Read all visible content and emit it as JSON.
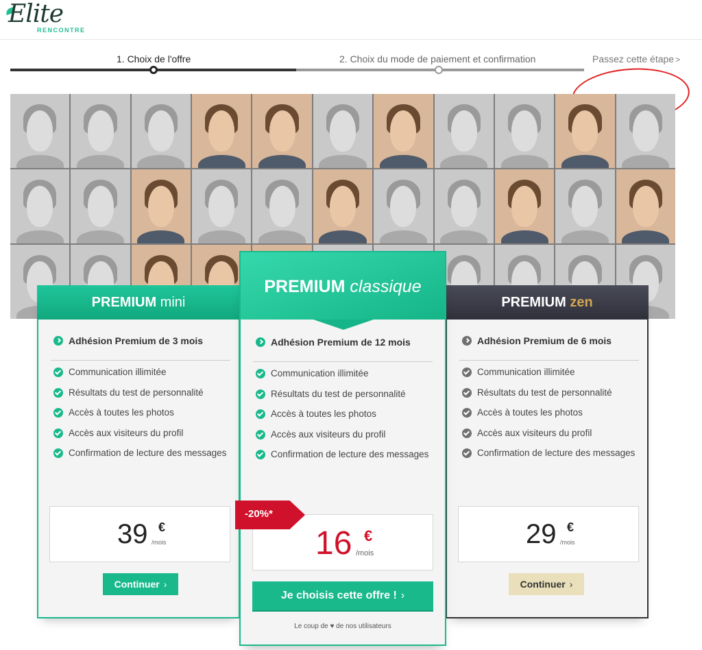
{
  "brand": {
    "logo_text": "Elite",
    "logo_sub": "RENCONTRE"
  },
  "steps": {
    "step1": "1. Choix de l'offre",
    "step2": "2. Choix du mode de paiement et confirmation",
    "skip": "Passez cette étape",
    "skip_icon": ">"
  },
  "plans": {
    "mini": {
      "title_bold": "PREMIUM",
      "title_rest": "mini",
      "main_feature": "Adhésion Premium de 3 mois",
      "features": [
        "Communication illimitée",
        "Résultats du test de personnalité",
        "Accès à toutes les photos",
        "Accès aux visiteurs du profil",
        "Confirmation de lecture des messages"
      ],
      "price": "39",
      "currency": "€",
      "per": "/mois",
      "button": "Continuer"
    },
    "classic": {
      "title_bold": "PREMIUM",
      "title_rest": "classique",
      "main_feature": "Adhésion Premium de 12 mois",
      "features": [
        "Communication illimitée",
        "Résultats du test de personnalité",
        "Accès à toutes les photos",
        "Accès aux visiteurs du profil",
        "Confirmation de lecture des messages"
      ],
      "badge": "-20%*",
      "price": "16",
      "currency": "€",
      "per": "/mois",
      "button": "Je choisis cette offre !",
      "tagline": "Le coup de ♥ de nos utilisateurs"
    },
    "zen": {
      "title_bold": "PREMIUM",
      "title_rest": "zen",
      "main_feature": "Adhésion Premium de 6 mois",
      "features": [
        "Communication illimitée",
        "Résultats du test de personnalité",
        "Accès à toutes les photos",
        "Accès aux visiteurs du profil",
        "Confirmation de lecture des messages"
      ],
      "price": "29",
      "currency": "€",
      "per": "/mois",
      "button": "Continuer"
    }
  },
  "colors": {
    "accent": "#19b98c",
    "price_red": "#d0112b",
    "zen_gold": "#d4a651",
    "zen_dark": "#333333"
  },
  "icons": {
    "check": "check-circle-icon",
    "chevron": "chevron-right-icon"
  }
}
